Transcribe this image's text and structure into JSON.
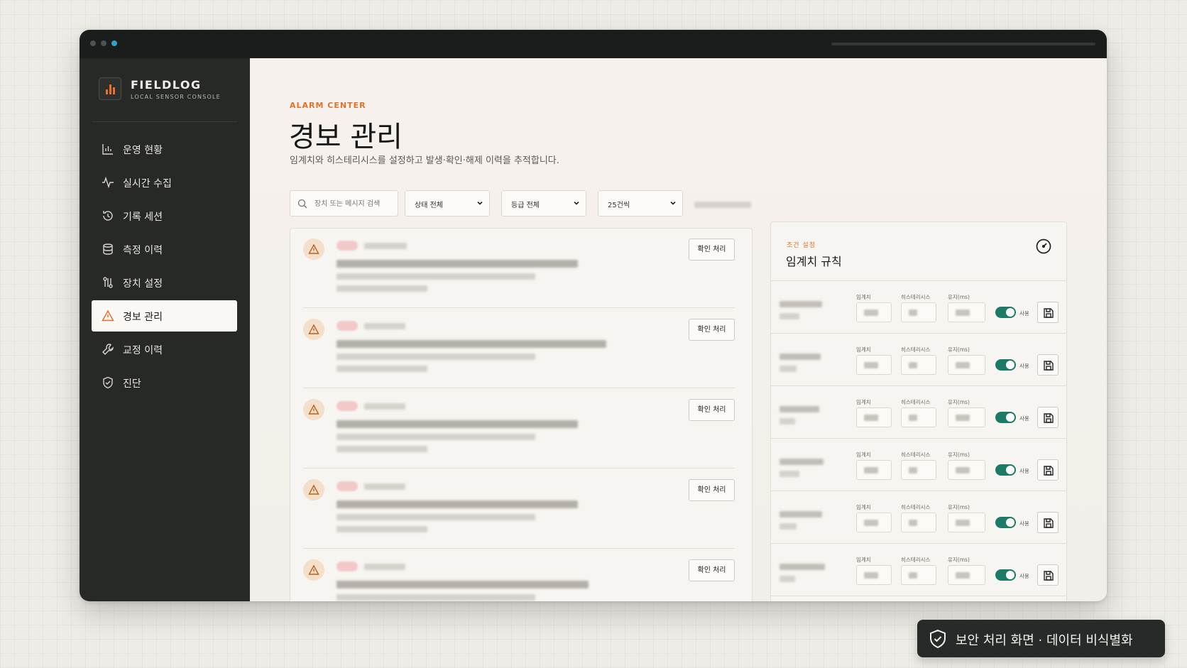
{
  "brand": {
    "name": "FIELDLOG",
    "subtitle": "LOCAL SENSOR CONSOLE"
  },
  "sidebar": {
    "items": [
      {
        "label": "운영 현황",
        "icon": "bar-chart-icon",
        "active": false
      },
      {
        "label": "실시간 수집",
        "icon": "activity-icon",
        "active": false
      },
      {
        "label": "기록 세션",
        "icon": "history-icon",
        "active": false
      },
      {
        "label": "측정 이력",
        "icon": "database-icon",
        "active": false
      },
      {
        "label": "장치 설정",
        "icon": "device-settings-icon",
        "active": false
      },
      {
        "label": "경보 관리",
        "icon": "warning-icon",
        "active": true
      },
      {
        "label": "교정 이력",
        "icon": "wrench-icon",
        "active": false
      },
      {
        "label": "진단",
        "icon": "shield-check-icon",
        "active": false
      }
    ]
  },
  "header": {
    "kicker": "ALARM CENTER",
    "title": "경보 관리",
    "description": "임계치와 히스테리시스를 설정하고 발생·확인·해제 이력을 추적합니다."
  },
  "filters": {
    "search_placeholder": "장치 또는 메시지 검색",
    "status": "상태 전체",
    "grade": "등급 전체",
    "page_size": "25건씩"
  },
  "alarms": {
    "ack_label": "확인 처리",
    "count": 5
  },
  "rules": {
    "kicker": "조건 설정",
    "title": "임계치 규칙",
    "threshold_label": "임계치",
    "hysteresis_label": "히스테리시스",
    "hold_label": "유지(ms)",
    "enabled_label": "사용",
    "rows": [
      {
        "enabled": true
      },
      {
        "enabled": true
      },
      {
        "enabled": true
      },
      {
        "enabled": true
      },
      {
        "enabled": true
      },
      {
        "enabled": true
      },
      {
        "enabled": true
      }
    ]
  },
  "banner": {
    "text": "보안 처리 화면 · 데이터 비식별화",
    "icon": "shield-check-icon"
  },
  "colors": {
    "accent": "#e0722b",
    "sidebar": "#262925",
    "toggle_on": "#1d7a66"
  }
}
